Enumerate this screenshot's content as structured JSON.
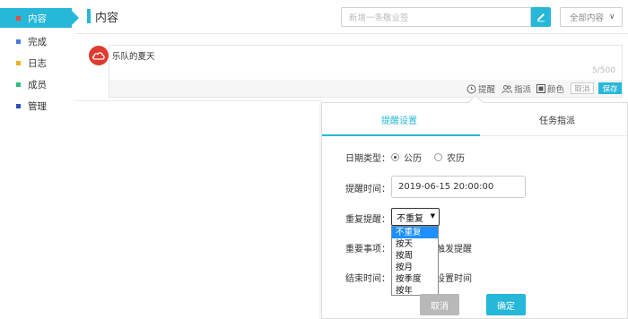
{
  "sidebar": {
    "items": [
      {
        "label": "内容",
        "color": "#e94b3c",
        "active": true
      },
      {
        "label": "完成",
        "color": "#4a7bd8"
      },
      {
        "label": "日志",
        "color": "#f2b01e"
      },
      {
        "label": "成员",
        "color": "#2ebd7a"
      },
      {
        "label": "管理",
        "color": "#2d4fb8"
      }
    ]
  },
  "header": {
    "title": "内容",
    "new_placeholder": "新增一条敬业签",
    "filter_value": "全部内容"
  },
  "compose": {
    "text": "乐队的夏天",
    "char_count": "5/500",
    "tools": {
      "remind": "提醒",
      "assign": "指派",
      "color": "颜色",
      "cancel": "取消",
      "save": "保存"
    }
  },
  "popup": {
    "tabs": [
      "提醒设置",
      "任务指派"
    ],
    "date_type_label": "日期类型：",
    "date_type_options": [
      "公历",
      "农历"
    ],
    "remind_time_label": "提醒时间：",
    "remind_time_value": "2019-06-15 20:00:00",
    "repeat_label": "重复提醒：",
    "repeat_selected": "不重复",
    "repeat_options": [
      "不重复",
      "按天",
      "按周",
      "按月",
      "按季度",
      "按年"
    ],
    "important_label": "重要事项：",
    "important_partial": "触发提醒",
    "end_time_label": "结束时间：",
    "end_time_partial": "设置时间",
    "cancel": "取消",
    "confirm": "确定"
  },
  "colors": {
    "accent": "#26b7d9",
    "dropdown_highlight": "#1e90ff"
  }
}
